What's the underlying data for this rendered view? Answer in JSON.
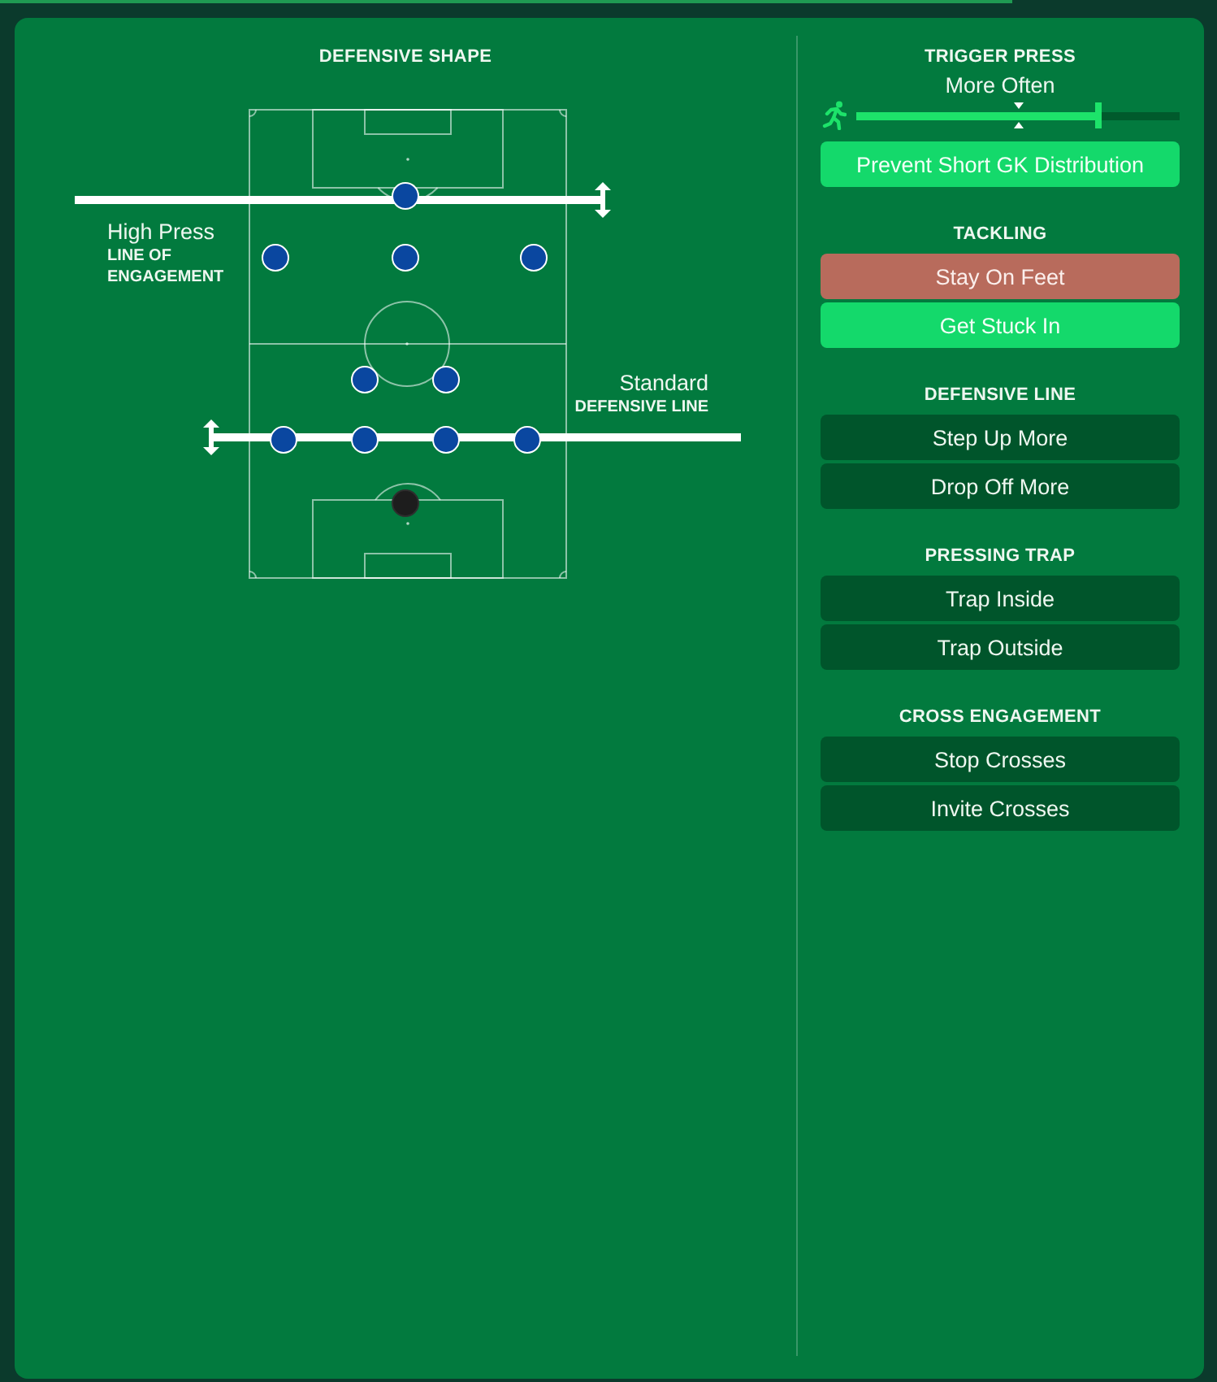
{
  "shape_panel": {
    "title": "DEFENSIVE SHAPE",
    "line_of_engagement": {
      "value": "High Press",
      "label": "LINE OF ENGAGEMENT"
    },
    "defensive_line": {
      "value": "Standard",
      "label": "DEFENSIVE LINE"
    }
  },
  "instructions": [
    {
      "heading": "TRIGGER PRESS",
      "kind": "slider",
      "reading": "More Often",
      "level": 0.75,
      "buttons": [
        {
          "label": "Prevent Short GK Distribution",
          "selected": true,
          "unavailable": false
        }
      ]
    },
    {
      "heading": "TACKLING",
      "kind": "options",
      "buttons": [
        {
          "label": "Stay On Feet",
          "selected": false,
          "unavailable": true
        },
        {
          "label": "Get Stuck In",
          "selected": true,
          "unavailable": false
        }
      ]
    },
    {
      "heading": "DEFENSIVE LINE",
      "kind": "options",
      "buttons": [
        {
          "label": "Step Up More",
          "selected": false,
          "unavailable": false
        },
        {
          "label": "Drop Off More",
          "selected": false,
          "unavailable": false
        }
      ]
    },
    {
      "heading": "PRESSING TRAP",
      "kind": "options",
      "buttons": [
        {
          "label": "Trap Inside",
          "selected": false,
          "unavailable": false
        },
        {
          "label": "Trap Outside",
          "selected": false,
          "unavailable": false
        }
      ]
    },
    {
      "heading": "CROSS ENGAGEMENT",
      "kind": "options",
      "buttons": [
        {
          "label": "Stop Crosses",
          "selected": false,
          "unavailable": false
        },
        {
          "label": "Invite Crosses",
          "selected": false,
          "unavailable": false
        }
      ]
    }
  ]
}
